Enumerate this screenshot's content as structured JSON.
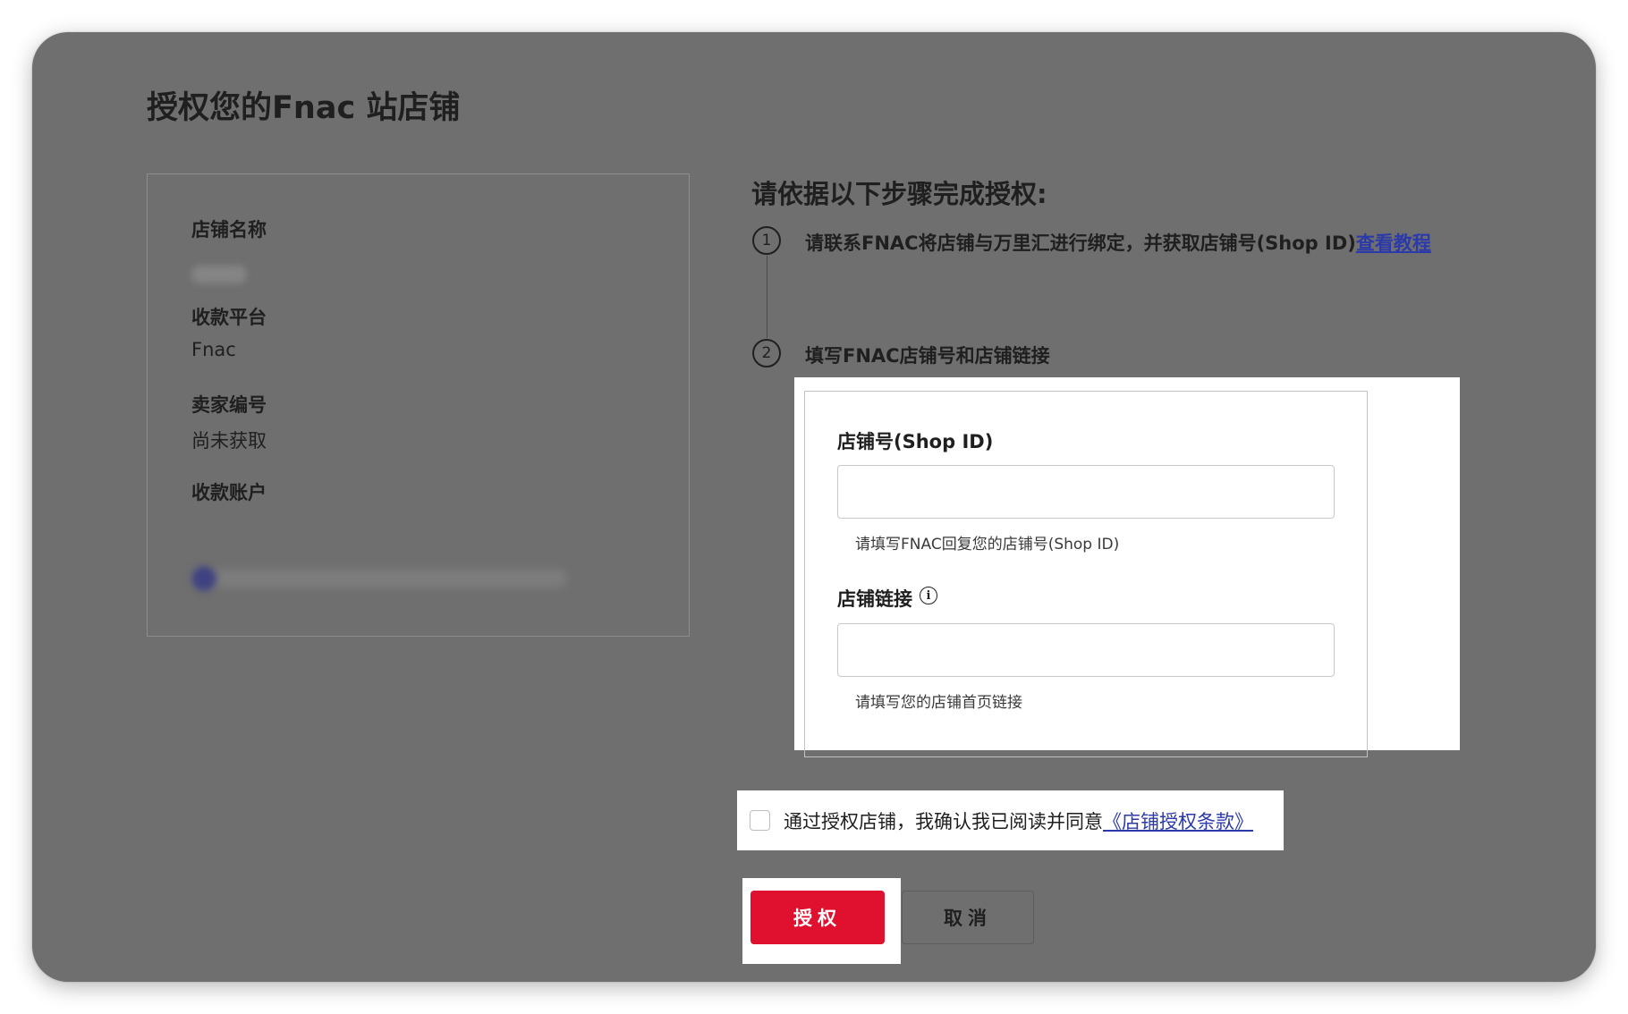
{
  "page": {
    "title": "授权您的Fnac 站店铺"
  },
  "store_info": {
    "name_label": "店铺名称",
    "platform_label": "收款平台",
    "platform_value": "Fnac",
    "seller_id_label": "卖家编号",
    "seller_id_value": "尚未获取",
    "account_label": "收款账户"
  },
  "steps": {
    "heading": "请依据以下步骤完成授权:",
    "step1": {
      "number": "1",
      "text": "请联系FNAC将店铺与万里汇进行绑定，并获取店铺号(Shop ID)",
      "link": "查看教程"
    },
    "step2": {
      "number": "2",
      "text": "填写FNAC店铺号和店铺链接"
    }
  },
  "form": {
    "shop_id_label": "店铺号(Shop ID)",
    "shop_id_value": "",
    "shop_id_help": "请填写FNAC回复您的店铺号(Shop ID)",
    "shop_link_label": "店铺链接",
    "shop_link_value": "",
    "shop_link_help": "请填写您的店铺首页链接",
    "info_icon": "i"
  },
  "agreement": {
    "text": "通过授权店铺，我确认我已阅读并同意",
    "link": "《店铺授权条款》",
    "checked": false
  },
  "actions": {
    "authorize": "授权",
    "cancel": "取消"
  },
  "colors": {
    "overlay": "#6f6f6f",
    "primary": "#e0102f",
    "link": "#2b3aa8"
  }
}
